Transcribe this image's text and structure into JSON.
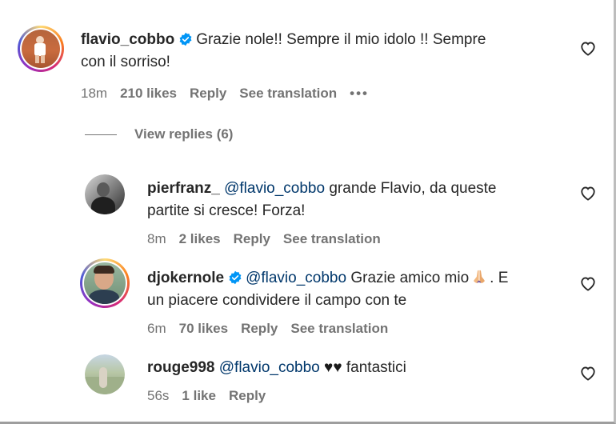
{
  "comments": [
    {
      "username": "flavio_cobbo",
      "verified": true,
      "text_line1": "Grazie nole!! Sempre il mio idolo !! Sempre",
      "text_line2": "con il sorriso!",
      "time": "18m",
      "likes": "210 likes",
      "reply": "Reply",
      "translation": "See translation",
      "more": "•••"
    }
  ],
  "view_replies": "View replies (6)",
  "replies": [
    {
      "username": "pierfranz_",
      "verified": false,
      "mention": "@flavio_cobbo",
      "text_line1": "grande Flavio, da queste",
      "text_line2": "partite si cresce! Forza!",
      "time": "8m",
      "likes": "2 likes",
      "reply": "Reply",
      "translation": "See translation"
    },
    {
      "username": "djokernole",
      "verified": true,
      "mention": "@flavio_cobbo",
      "text_line1_a": "Grazie amico mio",
      "text_line1_b": ". E",
      "text_line2": "un piacere condividere il campo con te",
      "time": "6m",
      "likes": "70 likes",
      "reply": "Reply",
      "translation": "See translation"
    },
    {
      "username": "rouge998",
      "verified": false,
      "mention": "@flavio_cobbo",
      "hearts": "♥♥",
      "text_line1": "fantastici",
      "time": "56s",
      "likes": "1 like",
      "reply": "Reply"
    }
  ],
  "icons": {
    "heart": "heart-outline-icon",
    "verified": "verified-badge-icon",
    "praying_hands": "praying-hands-emoji"
  },
  "colors": {
    "text": "#262626",
    "secondary": "#737373",
    "mention": "#00376b",
    "verified": "#0095f6"
  }
}
